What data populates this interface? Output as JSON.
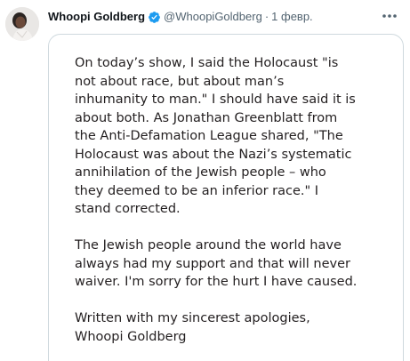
{
  "tweet": {
    "display_name": "Whoopi Goldberg",
    "handle": "@WhoopiGoldberg",
    "separator": "·",
    "date": "1 февр.",
    "avatar_icon": "profile-photo",
    "verified_icon": "verified-badge-icon",
    "more_icon": "more-options-icon",
    "verified_color": "#1d9bf0"
  },
  "statement": {
    "paragraphs": [
      "On today’s show, I said the Holocaust \"is\nnot about race, but about man’s\ninhumanity to man.\" I should have said it is\nabout both. As Jonathan Greenblatt from\nthe Anti-Defamation League shared, \"The\nHolocaust was about the Nazi’s systematic\nannihilation of the Jewish people – who\nthey deemed to be an inferior race.\" I\nstand corrected.",
      "The Jewish people around the world have\nalways had my support and that will never\nwaiver. I'm sorry for the hurt I have caused.",
      "Written with my sincerest apologies,\nWhoopi Goldberg"
    ]
  }
}
